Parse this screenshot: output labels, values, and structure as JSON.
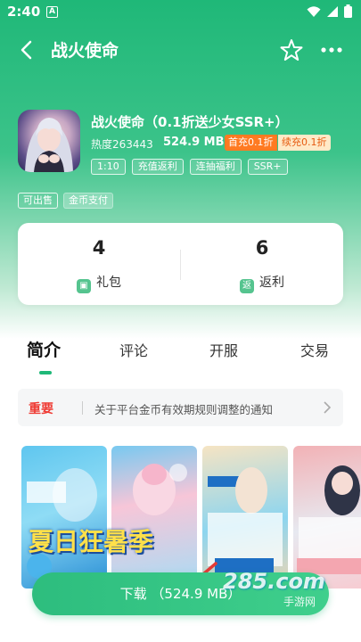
{
  "status": {
    "time": "2:40",
    "notif": "A"
  },
  "nav": {
    "title": "战火使命"
  },
  "game": {
    "name": "战火使命（0.1折送少女SSR+）",
    "heat": "热度263443",
    "size": "524.9 MB",
    "badge_first": "首充0.1折",
    "badge_continue": "续充0.1折",
    "tags": [
      "1:10",
      "充值返利",
      "连抽福利",
      "SSR+"
    ],
    "tags2": [
      "可出售",
      "金币支付"
    ]
  },
  "stats": [
    {
      "num": "4",
      "label": "礼包",
      "icon": "gift-icon"
    },
    {
      "num": "6",
      "label": "返利",
      "icon": "rebate-icon"
    }
  ],
  "tabs": [
    "简介",
    "评论",
    "开服",
    "交易"
  ],
  "notice": {
    "tag": "重要",
    "text": "关于平台金币有效期规则调整的通知"
  },
  "screenshots": {
    "banner": "夏日狂暑季"
  },
  "download": {
    "label": "下载",
    "size": "（524.9 MB）"
  },
  "watermark": {
    "text": "285.com",
    "sub": "手游网"
  },
  "colors": {
    "brand": "#1fb878",
    "important": "#ef3a33",
    "accent_orange": "#ff7a22"
  }
}
